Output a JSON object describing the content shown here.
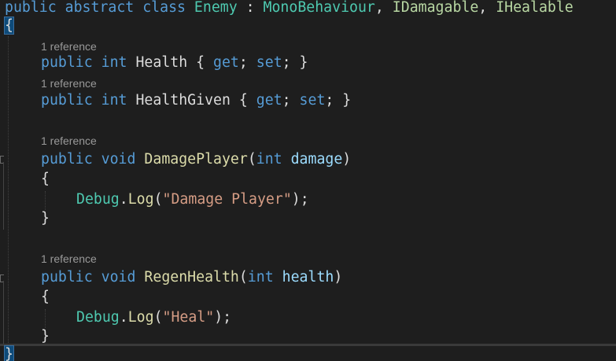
{
  "editor": {
    "background": "#1e1e1e",
    "colors": {
      "keyword": "#569cd6",
      "type": "#4ec9b0",
      "interface": "#b8d7a3",
      "parameter": "#9cdcfe",
      "method": "#dcdcaa",
      "string": "#d69d85",
      "codelens": "#999999"
    },
    "class_decl": {
      "kw1": "public",
      "kw2": "abstract",
      "kw3": "class",
      "name": "Enemy",
      "colon": " : ",
      "base": "MonoBehaviour",
      "comma1": ", ",
      "iface1": "IDamagable",
      "comma2": ", ",
      "iface2": "IHealable"
    },
    "open_brace": "{",
    "close_brace": "}",
    "codelens": {
      "health": "1 reference",
      "health_given": "1 reference",
      "damage_player": "1 reference",
      "regen_health": "1 reference"
    },
    "prop_health": {
      "kw1": "public",
      "type": "int",
      "name": "Health",
      "open": " { ",
      "get": "get",
      "semi1": "; ",
      "set": "set",
      "close": "; }"
    },
    "prop_health_given": {
      "kw1": "public",
      "type": "int",
      "name": "HealthGiven",
      "open": " { ",
      "get": "get",
      "semi1": "; ",
      "set": "set",
      "close": "; }"
    },
    "method_damage": {
      "kw1": "public",
      "ret": "void",
      "name": "DamagePlayer",
      "open": "(",
      "ptype": "int",
      "pname": "damage",
      "close": ")",
      "body_open": "{",
      "body_close": "}",
      "stmt_obj": "Debug",
      "stmt_dot": ".",
      "stmt_method": "Log",
      "stmt_open": "(",
      "stmt_str": "\"Damage Player\"",
      "stmt_close": ");"
    },
    "method_regen": {
      "kw1": "public",
      "ret": "void",
      "name": "RegenHealth",
      "open": "(",
      "ptype": "int",
      "pname": "health",
      "close": ")",
      "body_open": "{",
      "body_close": "}",
      "stmt_obj": "Debug",
      "stmt_dot": ".",
      "stmt_method": "Log",
      "stmt_open": "(",
      "stmt_str": "\"Heal\"",
      "stmt_close": ");"
    }
  }
}
